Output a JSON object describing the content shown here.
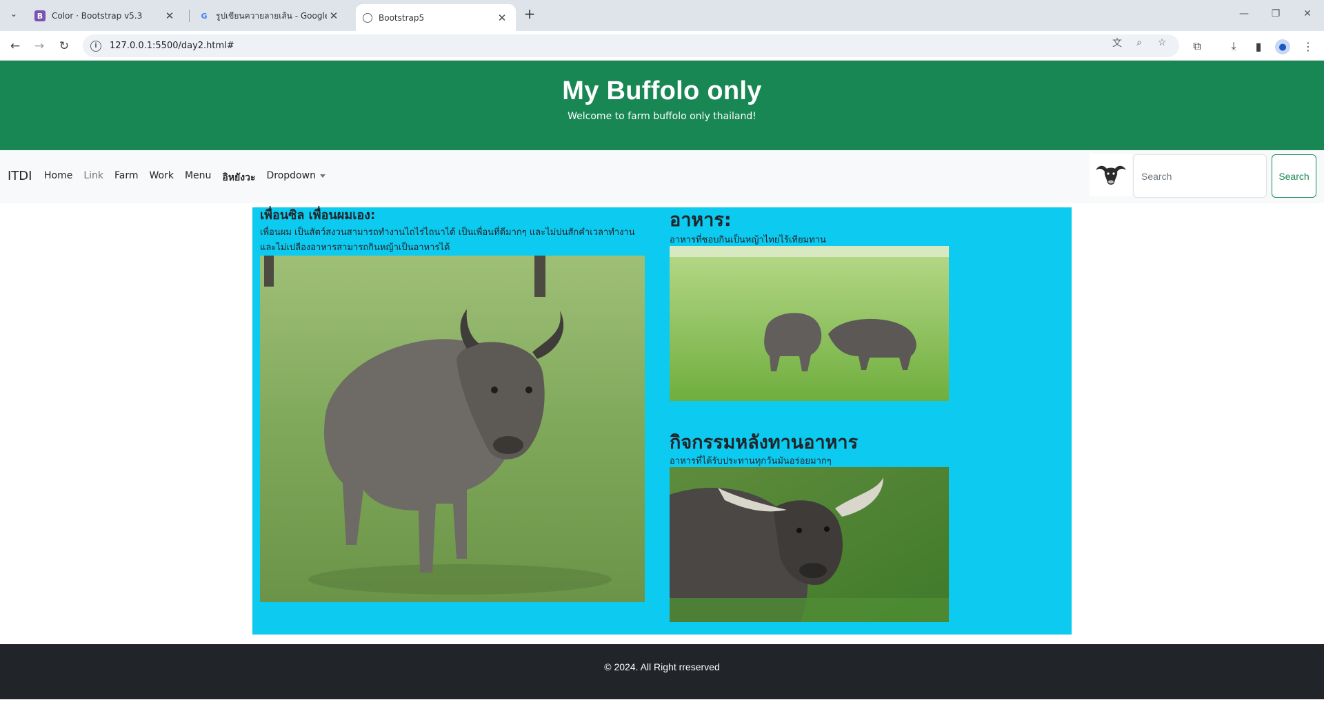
{
  "browser": {
    "tabs": [
      {
        "title": "Color · Bootstrap v5.3",
        "icon": "bootstrap-favicon"
      },
      {
        "title": "รูปเขียนควายลายเส้น - Google Sea",
        "icon": "google-favicon"
      },
      {
        "title": "Bootstrap5",
        "icon": "globe-favicon",
        "active": true
      }
    ],
    "url": "127.0.0.1:5500/day2.html#"
  },
  "hero": {
    "title": "My Buffolo only",
    "subtitle": "Welcome to farm buffolo only thailand!"
  },
  "navbar": {
    "brand": "ITDI",
    "links": [
      "Home",
      "Link",
      "Farm",
      "Work",
      "Menu",
      "อิหยังวะ",
      "Dropdown"
    ],
    "search_placeholder": "Search",
    "search_button": "Search"
  },
  "main": {
    "left": {
      "heading": "เพื่อนซิล เพื่อนผมเอง:",
      "text": "เพื่อนผม เป็นสัตว์สงวนสามารถทำงานไถไร่ไถนาได้ เป็นเพื่อนที่ดีมากๆ และไม่บ่นสักคำเวลาทำงาน และไม่เปลืองอาหารสามารถกินหญ้าเป็นอาหารได้"
    },
    "right_top": {
      "heading": "อาหาร:",
      "text": "อาหารที่ชอบกินเป็นหญ้าไทยไร้เทียมทาน"
    },
    "right_bottom": {
      "heading": "กิจกรรมหลังทานอาหาร",
      "text": "อาหารที่ได้รับประทานทุกวันมันอร่อยมากๆ"
    }
  },
  "footer": {
    "text": "© 2024. All Right rreserved"
  },
  "colors": {
    "hero_bg": "#198754",
    "content_bg": "#0dcaf0",
    "footer_bg": "#212529",
    "navbar_bg": "#f8f9fa"
  }
}
